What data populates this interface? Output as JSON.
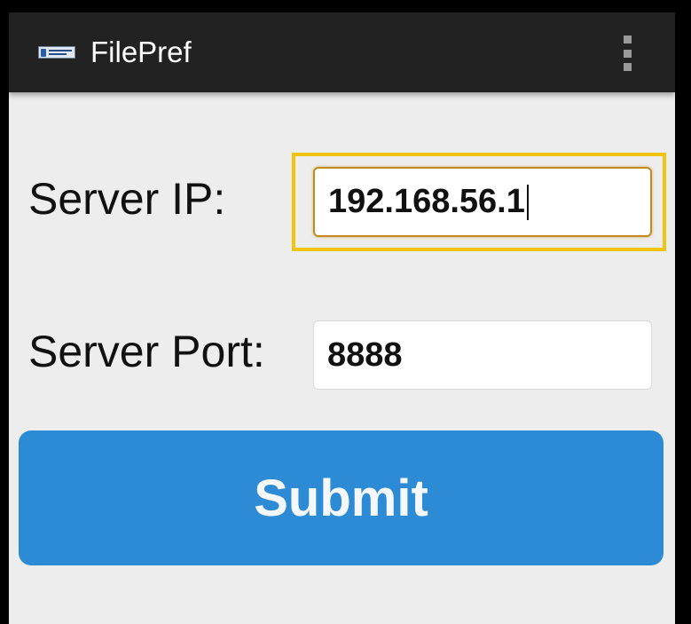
{
  "app": {
    "title": "FilePref",
    "icon": "security-innovation-logo-icon",
    "menu_icon": "overflow-menu-icon"
  },
  "form": {
    "server_ip_label": "Server IP:",
    "server_ip_value": "192.168.56.1",
    "server_port_label": "Server Port:",
    "server_port_value": "8888",
    "submit_label": "Submit"
  },
  "colors": {
    "action_bar": "#222222",
    "background": "#ededed",
    "submit": "#2d8bd6",
    "focus_highlight": "#f3c40f"
  }
}
